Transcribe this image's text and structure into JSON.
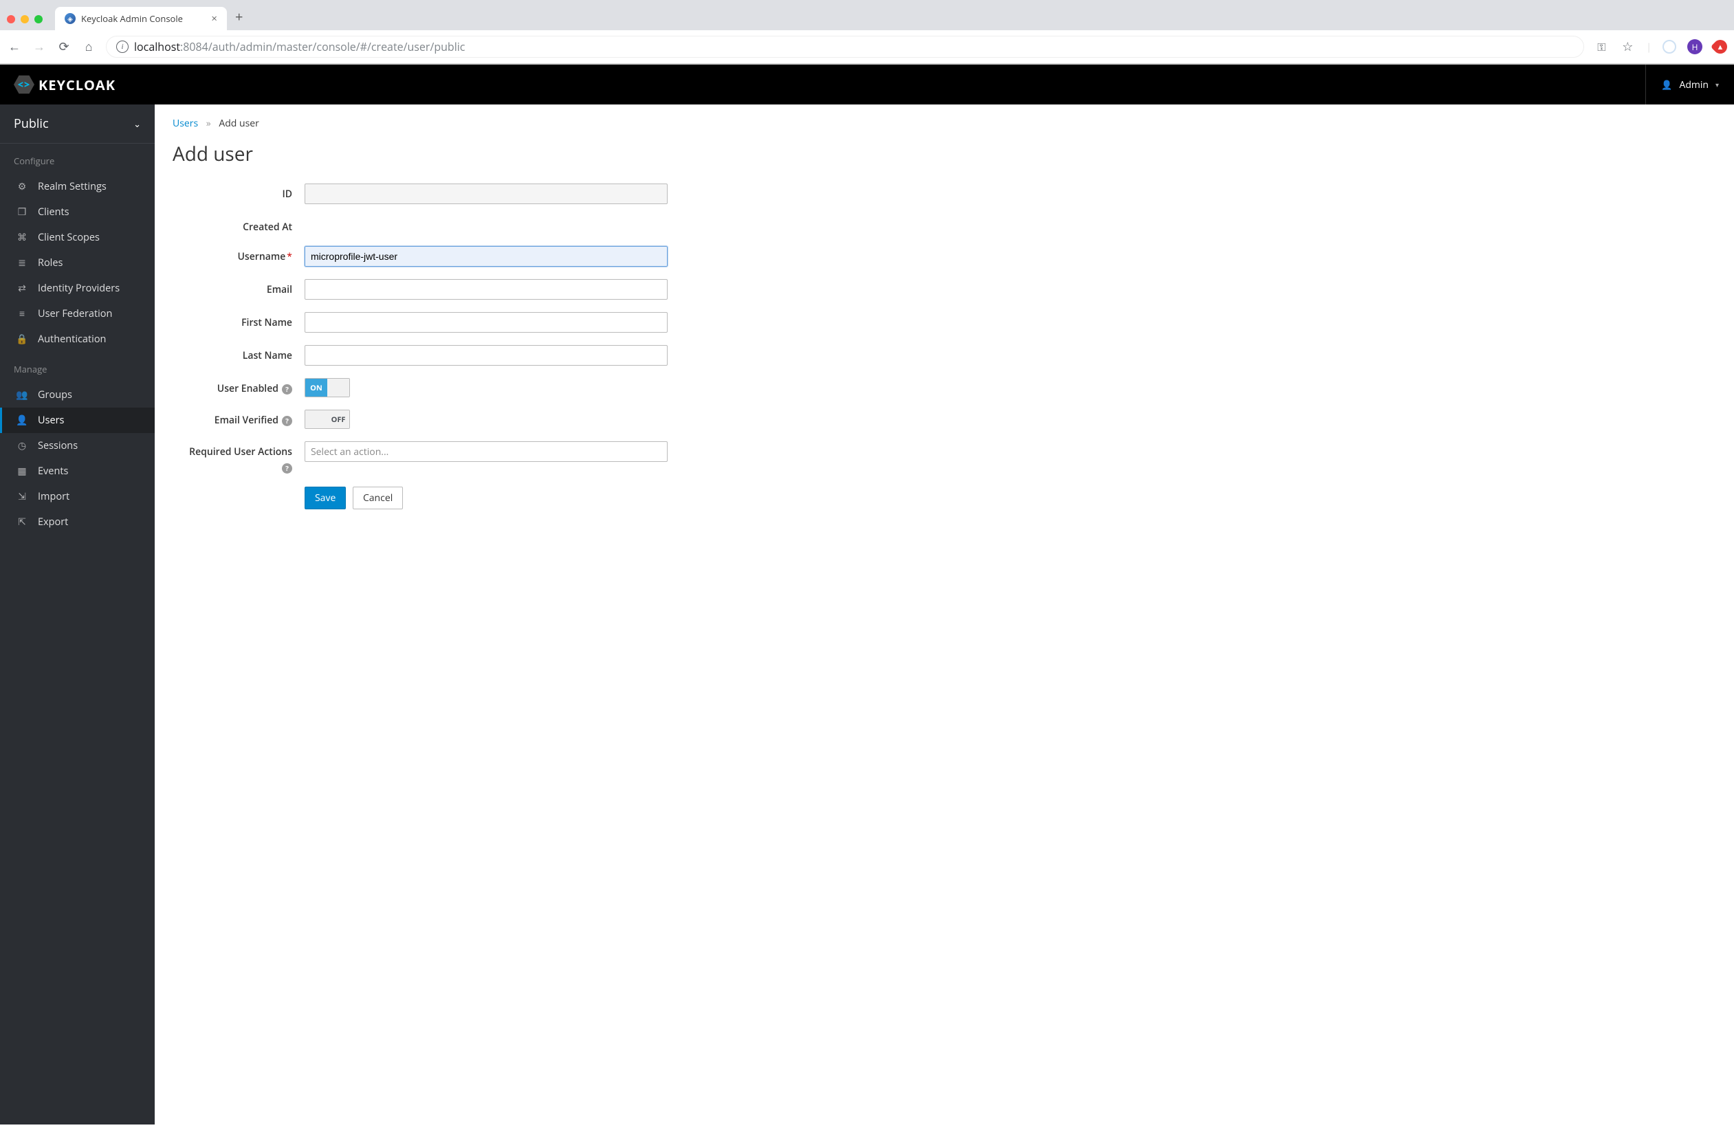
{
  "browser": {
    "tab_title": "Keycloak Admin Console",
    "url_host": "localhost",
    "url_rest": ":8084/auth/admin/master/console/#/create/user/public",
    "avatar_letter": "H"
  },
  "header": {
    "brand": "KEYCLOAK",
    "user_label": "Admin"
  },
  "sidebar": {
    "realm": "Public",
    "section_configure": "Configure",
    "section_manage": "Manage",
    "items_configure": [
      {
        "label": "Realm Settings"
      },
      {
        "label": "Clients"
      },
      {
        "label": "Client Scopes"
      },
      {
        "label": "Roles"
      },
      {
        "label": "Identity Providers"
      },
      {
        "label": "User Federation"
      },
      {
        "label": "Authentication"
      }
    ],
    "items_manage": [
      {
        "label": "Groups"
      },
      {
        "label": "Users"
      },
      {
        "label": "Sessions"
      },
      {
        "label": "Events"
      },
      {
        "label": "Import"
      },
      {
        "label": "Export"
      }
    ]
  },
  "breadcrumb": {
    "link": "Users",
    "current": "Add user"
  },
  "page": {
    "title": "Add user"
  },
  "form": {
    "id_label": "ID",
    "id_value": "",
    "created_at_label": "Created At",
    "username_label": "Username",
    "username_value": "microprofile-jwt-user",
    "email_label": "Email",
    "email_value": "",
    "first_name_label": "First Name",
    "first_name_value": "",
    "last_name_label": "Last Name",
    "last_name_value": "",
    "user_enabled_label": "User Enabled",
    "user_enabled_on": "ON",
    "email_verified_label": "Email Verified",
    "email_verified_off": "OFF",
    "required_actions_label": "Required User Actions",
    "required_actions_placeholder": "Select an action...",
    "save_label": "Save",
    "cancel_label": "Cancel"
  }
}
